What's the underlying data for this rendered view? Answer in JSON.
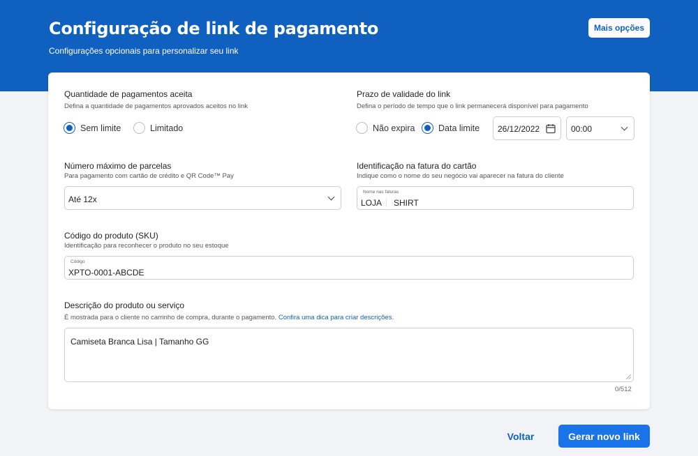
{
  "header": {
    "title": "Configuração de link de pagamento",
    "subtitle": "Configurações opcionais para personalizar seu link",
    "more_options_label": "Mais opções"
  },
  "payments_accepted": {
    "title": "Quantidade de pagamentos aceita",
    "description": "Defina a quantidade de pagamentos aprovados aceitos no link",
    "options": [
      {
        "label": "Sem limite",
        "selected": true
      },
      {
        "label": "Limitado",
        "selected": false
      }
    ]
  },
  "validity": {
    "title": "Prazo de validade do link",
    "description": "Defina o período de tempo que o link permanecerá disponível para pagamento",
    "options": [
      {
        "label": "Não expira",
        "selected": false
      },
      {
        "label": "Data limite",
        "selected": true
      }
    ],
    "date_value": "26/12/2022",
    "time_value": "00:00"
  },
  "installments": {
    "title": "Número máximo de parcelas",
    "description": "Para pagamento com cartão de crédito e QR Code™ Pay",
    "selected_value": "Até 12x"
  },
  "invoice_id": {
    "title": "Identificação na fatura do cartão",
    "description": "Indique como o nome do seu negócio vai aparecer na fatura do cliente",
    "field_label": "Nome nas faturas",
    "value_part1": "LOJA",
    "value_part2": "SHIRT"
  },
  "sku": {
    "title": "Código do produto (SKU)",
    "description": "Identificação para reconhecer o produto no seu estoque",
    "field_label": "Código",
    "value": "XPTO-0001-ABCDE"
  },
  "product_description": {
    "title": "Descrição do produto ou serviço",
    "description": "É mostrada para o cliente no carrinho de compra, durante o pagamento.",
    "tip_link": "Confira uma dica para criar descrições.",
    "value": "Camiseta Branca Lisa | Tamanho GG",
    "counter": "0/512"
  },
  "footer": {
    "back_label": "Voltar",
    "generate_label": "Gerar novo link"
  },
  "colors": {
    "primary": "#1060bf",
    "header_bg": "#1060bf",
    "page_bg": "#f2f3f7"
  }
}
